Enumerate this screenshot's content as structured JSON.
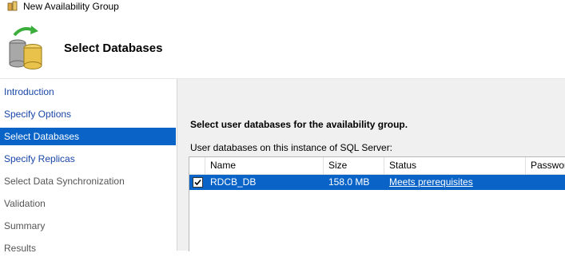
{
  "window": {
    "title": "New Availability Group"
  },
  "header": {
    "title": "Select Databases"
  },
  "sidebar": {
    "items": [
      {
        "label": "Introduction",
        "state": "link"
      },
      {
        "label": "Specify Options",
        "state": "link"
      },
      {
        "label": "Select Databases",
        "state": "active"
      },
      {
        "label": "Specify Replicas",
        "state": "link"
      },
      {
        "label": "Select Data Synchronization",
        "state": "disabled"
      },
      {
        "label": "Validation",
        "state": "disabled"
      },
      {
        "label": "Summary",
        "state": "disabled"
      },
      {
        "label": "Results",
        "state": "disabled"
      }
    ]
  },
  "main": {
    "heading": "Select user databases for the availability group.",
    "grid_label": "User databases on this instance of SQL Server:",
    "columns": [
      "Name",
      "Size",
      "Status",
      "Password"
    ],
    "rows": [
      {
        "checked": true,
        "name": "RDCB_DB",
        "size": "158.0 MB",
        "status": "Meets prerequisites",
        "password": ""
      }
    ]
  },
  "colors": {
    "selection": "#0a64c8",
    "link": "#1a47a8"
  }
}
